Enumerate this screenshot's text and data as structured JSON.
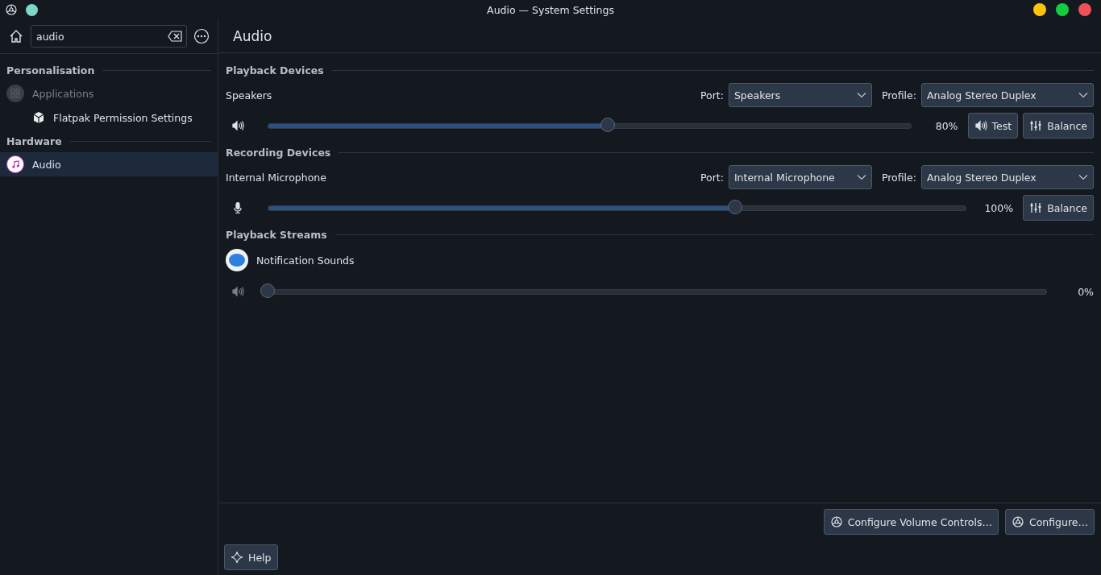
{
  "window": {
    "title": "Audio — System Settings"
  },
  "sidebar": {
    "search": {
      "value": "audio"
    },
    "groups": [
      {
        "title": "Personalisation",
        "items": [
          {
            "label": "Applications",
            "kind": "apps",
            "disabled": true,
            "selected": false,
            "children": [
              {
                "label": "Flatpak Permission Settings",
                "kind": "flatpak",
                "disabled": false,
                "selected": false
              }
            ]
          }
        ]
      },
      {
        "title": "Hardware",
        "items": [
          {
            "label": "Audio",
            "kind": "audio",
            "disabled": false,
            "selected": true
          }
        ]
      }
    ]
  },
  "page": {
    "title": "Audio",
    "sections": [
      {
        "title": "Playback Devices",
        "entries": [
          {
            "kind": "output_device",
            "name": "Speakers",
            "port_label": "Port:",
            "port": "Speakers",
            "profile_label": "Profile:",
            "profile": "Analog Stereo Duplex",
            "level": 0.53,
            "reading": "80%",
            "buttons": [
              {
                "kind": "test",
                "label": "Test"
              },
              {
                "kind": "balance",
                "label": "Balance"
              }
            ]
          }
        ]
      },
      {
        "title": "Recording Devices",
        "entries": [
          {
            "kind": "input_device",
            "name": "Internal Microphone",
            "port_label": "Port:",
            "port": "Internal Microphone",
            "profile_label": "Profile:",
            "profile": "Analog Stereo Duplex",
            "level": 0.67,
            "reading": "100%",
            "buttons": [
              {
                "kind": "balance",
                "label": "Balance"
              }
            ]
          }
        ]
      },
      {
        "title": "Playback Streams",
        "entries": [
          {
            "kind": "stream",
            "name": "Notification Sounds",
            "level": 0,
            "reading": "0%"
          }
        ]
      }
    ],
    "footer_buttons": [
      "Configure Volume Controls…",
      "Configure…"
    ]
  },
  "help_button": "Help"
}
